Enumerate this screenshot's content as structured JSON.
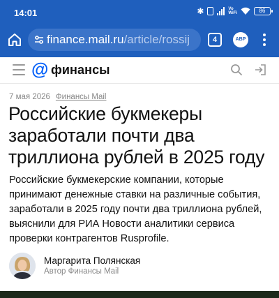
{
  "status_bar": {
    "time": "14:01",
    "network_label": "Vo\nWiFi",
    "battery": "86"
  },
  "browser": {
    "url_host": "finance.mail.ru",
    "url_path": "/article/rossij",
    "tab_count": "4",
    "abp_label": "ABP"
  },
  "site": {
    "logo_symbol": "@",
    "logo_text": "финансы",
    "accent_color": "#005ff9"
  },
  "article": {
    "date": "7 мая 2026",
    "source": "Финансы Mail",
    "title": "Российские букмекеры заработали почти два триллиона рублей в 2025 году",
    "lead": "Российские букмекерские компании, которые принимают денежные ставки на различные события, заработали в 2025 году почти два триллиона рублей, выяснили для РИА Новости аналитики сервиса проверки контрагентов Rusprofile.",
    "author": {
      "name": "Маргарита Полянская",
      "role": "Автор Финансы Mail"
    }
  },
  "colors": {
    "browser_bar": "#1f5fbd",
    "url_box": "#3b74c9"
  },
  "icons": [
    "home-icon",
    "tune-icon",
    "search-icon",
    "login-icon",
    "menu-icon",
    "wifi-icon",
    "bluetooth-icon",
    "vibrate-icon",
    "signal-icon",
    "battery-icon"
  ]
}
